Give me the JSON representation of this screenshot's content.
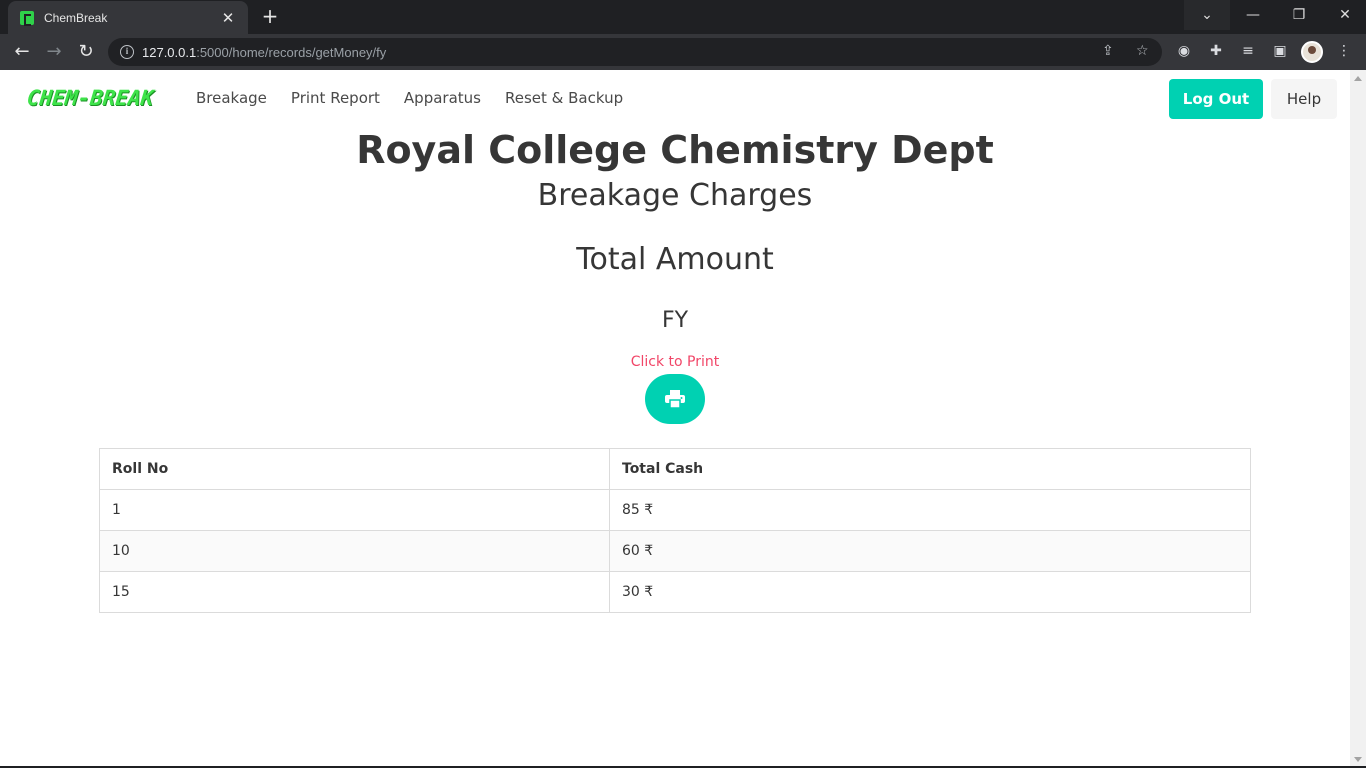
{
  "browser": {
    "tab_title": "ChemBreak",
    "url_host": "127.0.0.1",
    "url_path": ":5000/home/records/getMoney/fy"
  },
  "navbar": {
    "brand": "CHEM-BREAK",
    "items": [
      {
        "label": "Breakage"
      },
      {
        "label": "Print Report"
      },
      {
        "label": "Apparatus"
      },
      {
        "label": "Reset & Backup"
      }
    ],
    "logout_label": "Log Out",
    "help_label": "Help"
  },
  "header": {
    "title": "Royal College Chemistry Dept",
    "subtitle": "Breakage Charges",
    "section": "Total Amount",
    "year": "FY",
    "print_label": "Click to Print"
  },
  "table": {
    "headers": [
      "Roll No",
      "Total Cash"
    ],
    "rows": [
      [
        "1",
        "85 ₹"
      ],
      [
        "10",
        "60 ₹"
      ],
      [
        "15",
        "30 ₹"
      ]
    ]
  },
  "colors": {
    "primary": "#00d1b2",
    "danger": "#f14668",
    "brand": "#3ee34a"
  }
}
